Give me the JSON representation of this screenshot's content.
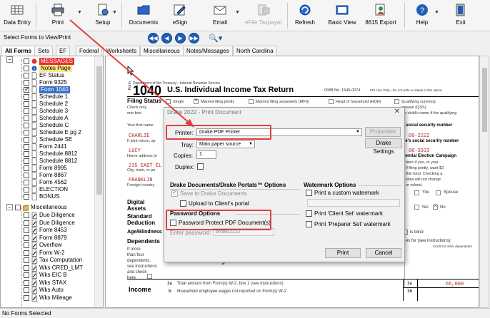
{
  "toolbar": {
    "items": [
      {
        "label": "Data Entry",
        "icon": "grid-icon"
      },
      {
        "label": "Print",
        "icon": "printer-icon"
      },
      {
        "label": "Setup",
        "icon": "gear-document-icon"
      },
      {
        "label": "Documents",
        "icon": "folder-icon"
      },
      {
        "label": "eSign",
        "icon": "pen-icon"
      },
      {
        "label": "Email",
        "icon": "envelope-icon"
      },
      {
        "label": "eFile Taxpayer",
        "icon": "efile-icon"
      },
      {
        "label": "Refresh",
        "icon": "refresh-icon"
      },
      {
        "label": "Basic View",
        "icon": "basic-view-icon"
      },
      {
        "label": "8615 Export",
        "icon": "person-export-icon"
      },
      {
        "label": "Help",
        "icon": "help-icon"
      },
      {
        "label": "Exit",
        "icon": "exit-icon"
      }
    ]
  },
  "row2": {
    "select_label": "Select Forms to View/Print"
  },
  "tabs": [
    "All Forms",
    "Sets",
    "EF",
    "Federal",
    "Worksheets",
    "Miscellaneous",
    "Notes/Messages",
    "North Carolina"
  ],
  "tree": {
    "federal_items": [
      {
        "label": "MESSAGES",
        "style": "red",
        "checked": false
      },
      {
        "label": "Notes Page",
        "style": "yellow",
        "checked": false
      },
      {
        "label": "EF Status",
        "style": "",
        "checked": false
      },
      {
        "label": "Form 9325",
        "style": "",
        "checked": false
      },
      {
        "label": "Form 1040",
        "style": "blue",
        "checked": true
      },
      {
        "label": "Schedule 1",
        "style": "",
        "checked": false
      },
      {
        "label": "Schedule 2",
        "style": "",
        "checked": false
      },
      {
        "label": "Schedule 3",
        "style": "",
        "checked": false
      },
      {
        "label": "Schedule A",
        "style": "",
        "checked": false
      },
      {
        "label": "Schedule C",
        "style": "",
        "checked": false
      },
      {
        "label": "Schedule E pg 2",
        "style": "",
        "checked": false
      },
      {
        "label": "Schedule SE",
        "style": "",
        "checked": false
      },
      {
        "label": "Form 2441",
        "style": "",
        "checked": false
      },
      {
        "label": "Schedule 8812",
        "style": "",
        "checked": false
      },
      {
        "label": "Schedule 8812",
        "style": "",
        "checked": false
      },
      {
        "label": "Form 8995",
        "style": "",
        "checked": false
      },
      {
        "label": "Form 8867",
        "style": "",
        "checked": false
      },
      {
        "label": "Form 4562",
        "style": "",
        "checked": false
      },
      {
        "label": "ELECTION",
        "style": "",
        "checked": false
      },
      {
        "label": "BONUS",
        "style": "",
        "checked": false
      }
    ],
    "misc_label": "Miscellaneous",
    "misc_items": [
      "Due Diligence",
      "Due Diligence",
      "Form 8453",
      "Form 8879",
      "Overflow",
      "Form W-2",
      "Tax Computation",
      "Wks CRED_LMT",
      "Wks EIC B",
      "Wks STAX",
      "Wks Auto",
      "Wks Mileage"
    ]
  },
  "form": {
    "dept": "Department of the Treasury—Internal Revenue Service",
    "form_no": "1040",
    "form_year_prefix": "Form",
    "title": "U.S. Individual Income Tax Return",
    "omb": "OMB No. 1545-0074",
    "irs_use": "IRS Use Only—Do not write or staple in this space.",
    "filing_status": "Filing Status",
    "check_only": "Check only",
    "one_box": "one box.",
    "fs_single": "Single",
    "fs_mfj": "Married filing jointly",
    "fs_mfs": "Married filing separately (MFS)",
    "fs_hoh": "Head of household (HOH)",
    "fs_qss": "Qualifying surviving",
    "fs_qss2": "spouse (QSS)",
    "fs_qss3": "e child's name if the qualifying",
    "first_name": "Your first name",
    "taxpayer": "CHARLIE",
    "joint_return": "If joint return, sp",
    "spouse": "LUCY",
    "home_address": "Home address (n",
    "address": "235 EAST EL",
    "city_label": "City, town, or po",
    "city": "FRANKLIN",
    "foreign": "Foreign country",
    "ssn_label": "social security number",
    "ssn": "00-2222",
    "spouse_ssn_label": "se's social security number",
    "spouse_ssn": "00-3333",
    "campaign": "dential Election Campaign",
    "campaign2": "here if you, or your",
    "campaign3": "if filing jointly, want $3",
    "campaign4": "this fund. Checking a",
    "campaign5": "elow will not change",
    "campaign6": "or refund.",
    "you": "You",
    "spouse_lbl": "Spouse",
    "digital": "Digital",
    "assets": "Assets",
    "standard": "Standard",
    "deduction": "Deduction",
    "yes": "Yes",
    "no": "No",
    "age_blind": "Age/Blindness",
    "dependents": "Dependents",
    "if_more": "If more",
    "than_four": "than four",
    "dependents2": "dependents,",
    "see_instr": "see instructions",
    "and_check": "and check",
    "here": "here",
    "is_blind": "is blind",
    "for_see": "es for (see instructions):",
    "credit_other": "Credit for other dependents",
    "income": "Income",
    "line1a": "1a",
    "line1a_txt": "Total amount from Form(s) W-2, box 1 (see instructions)",
    "line1a_val": "65,000",
    "line1b": "b",
    "line1b_txt": "Household employee wages not reported on Form(s) W-2",
    "line1b_box": "1b",
    "line1a_box": "1a"
  },
  "dialog": {
    "title": "Drake 2022 - Print Document",
    "printer_label": "Printer:",
    "printer_value": "Drake PDF Printer",
    "properties": "Properties",
    "tray_label": "Tray:",
    "tray_value": "Main paper source",
    "drake_settings": "Drake Settings",
    "copies_label": "Copies:",
    "copies_value": "1",
    "duplex_label": "Duplex:",
    "portals_header": "Drake Documents/Drake Portals™ Options",
    "save_to_drake": "Save to Drake Documents",
    "upload_portal": "Upload to Client's portal",
    "password_header": "Password Options",
    "password_protect": "Password Protect PDF Document(s)",
    "enter_password": "Enter password:",
    "password_value": "brow02222",
    "watermark_header": "Watermark Options",
    "custom_watermark": "Print a custom watermark",
    "client_set": "Print 'Client Set' watermark",
    "preparer_set": "Print 'Preparer Set' watermark",
    "print": "Print",
    "cancel": "Cancel"
  },
  "status": {
    "text": "No Forms Selected"
  },
  "colors": {
    "accent_red": "#e04040",
    "nav_blue": "#1f5fb6",
    "checked_green": "#1b9b1b"
  }
}
